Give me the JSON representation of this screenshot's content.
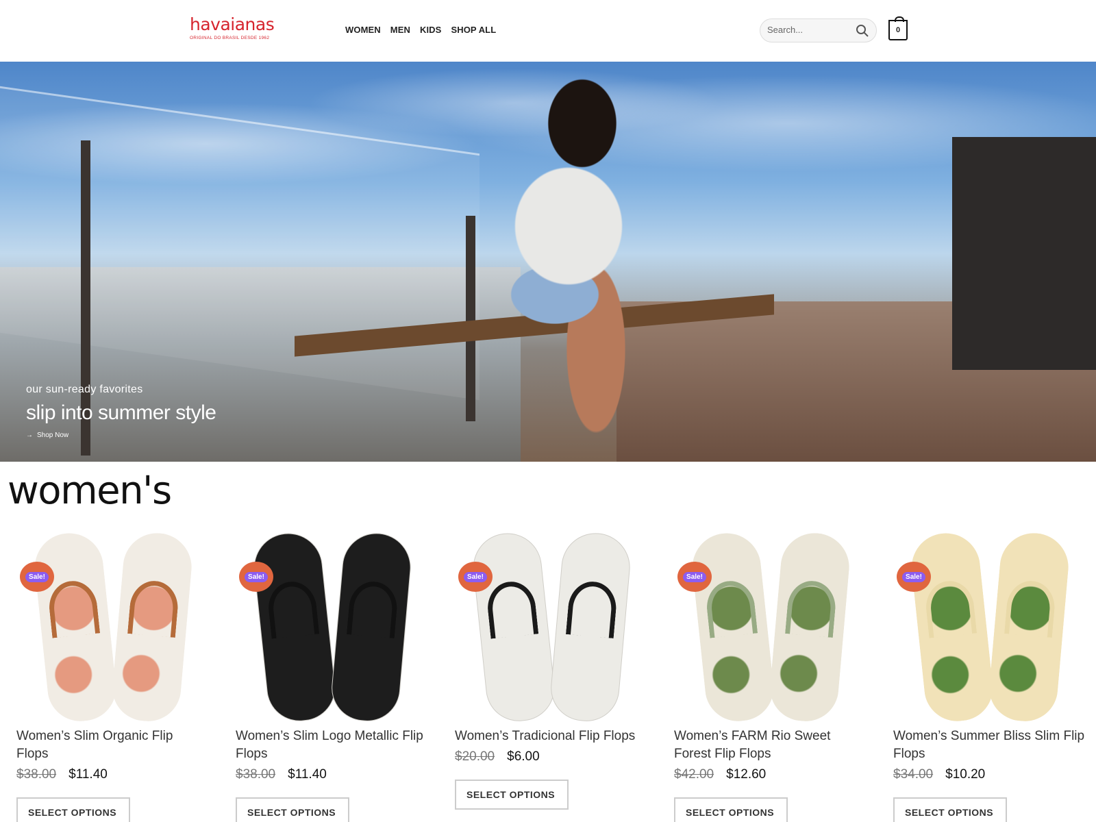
{
  "header": {
    "logo": {
      "word": "havaianas",
      "tagline": "ORIGINAL DO BRASIL DESDE 1962"
    },
    "nav": [
      "WOMEN",
      "MEN",
      "KIDS",
      "SHOP ALL"
    ],
    "search": {
      "placeholder": "Search..."
    },
    "cart": {
      "count": "0"
    }
  },
  "hero": {
    "subtitle": "our sun-ready favorites",
    "title": "slip into summer style",
    "link": "Shop Now"
  },
  "section": {
    "title": "women's"
  },
  "products": [
    {
      "name": "Women’s Slim Organic Flip Flops",
      "old_price": "$38.00",
      "new_price": "$11.40",
      "badge": "Sale!",
      "button": "SELECT OPTIONS",
      "sole": "#f1ece4",
      "pattern": "#e59a80",
      "strap": "#b56b3a"
    },
    {
      "name": "Women’s Slim Logo Metallic Flip Flops",
      "old_price": "$38.00",
      "new_price": "$11.40",
      "badge": "Sale!",
      "button": "SELECT OPTIONS",
      "sole": "#1d1d1d",
      "pattern": "#1d1d1d",
      "strap": "#111111"
    },
    {
      "name": "Women’s Tradicional Flip Flops",
      "old_price": "$20.00",
      "new_price": "$6.00",
      "badge": "Sale!",
      "button": "SELECT OPTIONS",
      "sole": "#ecebe6",
      "pattern": "#ecebe6",
      "strap": "#1a1a1a"
    },
    {
      "name": "Women’s FARM Rio Sweet Forest Flip Flops",
      "old_price": "$42.00",
      "new_price": "$12.60",
      "badge": "Sale!",
      "button": "SELECT OPTIONS",
      "sole": "#ebe6d8",
      "pattern": "#6d8a4c",
      "strap": "#98ab84"
    },
    {
      "name": "Women’s Summer Bliss Slim Flip Flops",
      "old_price": "$34.00",
      "new_price": "$10.20",
      "badge": "Sale!",
      "button": "SELECT OPTIONS",
      "sole": "#f1e2b8",
      "pattern": "#5b8a3e",
      "strap": "#e9d9a8"
    }
  ]
}
